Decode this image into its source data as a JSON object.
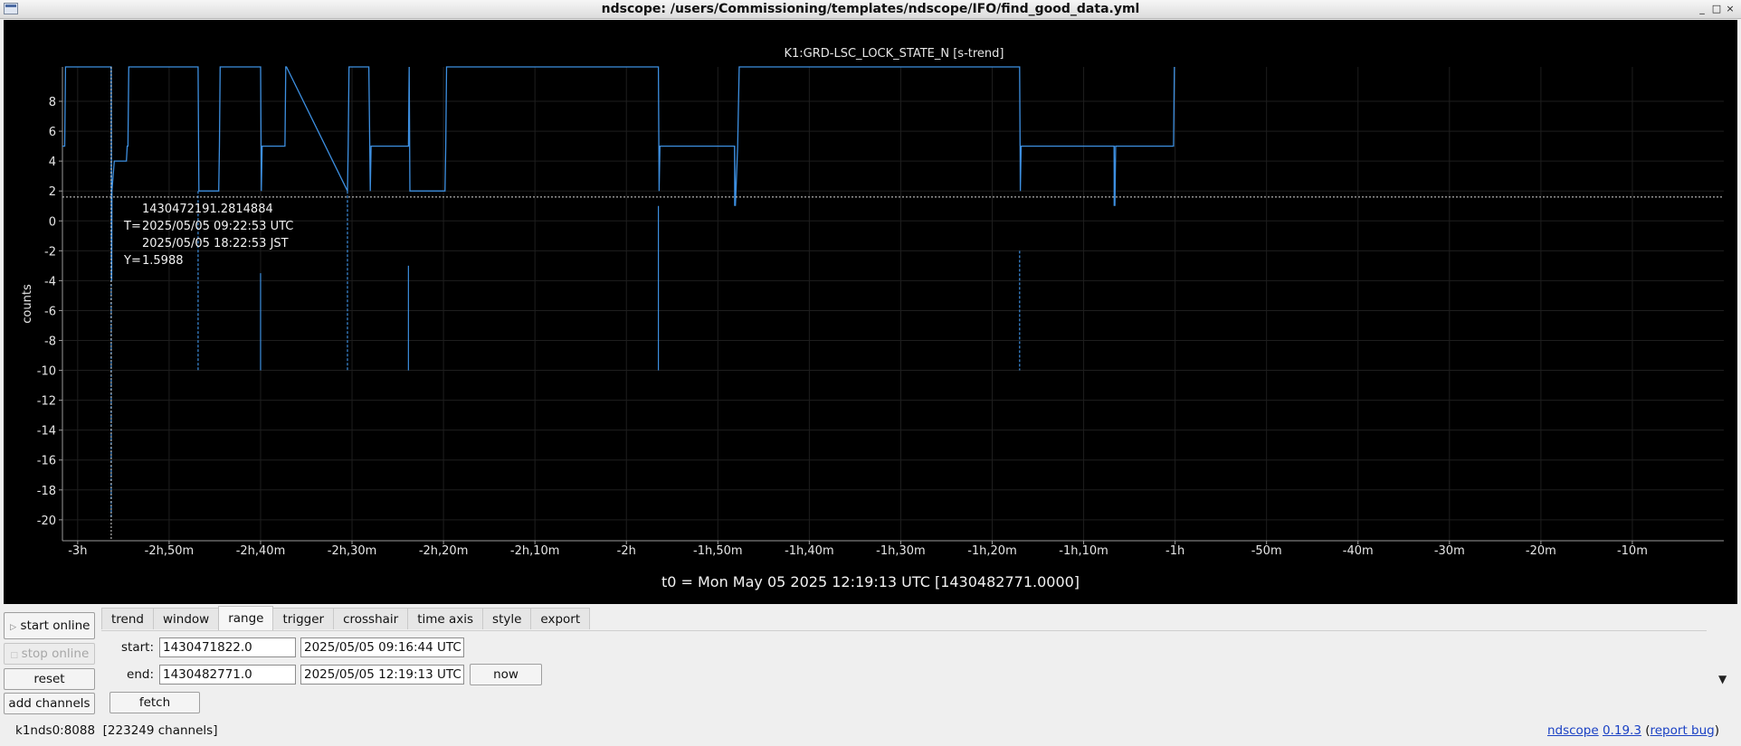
{
  "window": {
    "title": "ndscope: /users/Commissioning/templates/ndscope/IFO/find_good_data.yml",
    "controls": [
      "_",
      "□",
      "×"
    ]
  },
  "plot": {
    "channel_title": "K1:GRD-LSC_LOCK_STATE_N [s-trend]",
    "t0_label": "t0 = Mon May 05 2025 12:19:13 UTC [1430482771.0000]",
    "crosshair": {
      "gps": "1430472191.2814884",
      "t_prefix": "T=",
      "utc": "2025/05/05 09:22:53 UTC",
      "jst": "2025/05/05 18:22:53 JST",
      "y_prefix": "Y=",
      "y_value": "1.5988"
    }
  },
  "chart_data": {
    "type": "line",
    "title": "K1:GRD-LSC_LOCK_STATE_N [s-trend]",
    "xlabel": "t0 = Mon May 05 2025 12:19:13 UTC [1430482771.0000]",
    "ylabel": "counts",
    "xlim": [
      -10900,
      0
    ],
    "ylim": [
      -21.4,
      10.3
    ],
    "grid": true,
    "x_unit": "seconds relative to t0",
    "xticks": [
      {
        "value": -10800,
        "label": "-3h"
      },
      {
        "value": -10200,
        "label": "-2h,50m"
      },
      {
        "value": -9600,
        "label": "-2h,40m"
      },
      {
        "value": -9000,
        "label": "-2h,30m"
      },
      {
        "value": -8400,
        "label": "-2h,20m"
      },
      {
        "value": -7800,
        "label": "-2h,10m"
      },
      {
        "value": -7200,
        "label": "-2h"
      },
      {
        "value": -6600,
        "label": "-1h,50m"
      },
      {
        "value": -6000,
        "label": "-1h,40m"
      },
      {
        "value": -5400,
        "label": "-1h,30m"
      },
      {
        "value": -4800,
        "label": "-1h,20m"
      },
      {
        "value": -4200,
        "label": "-1h,10m"
      },
      {
        "value": -3600,
        "label": "-1h"
      },
      {
        "value": -3000,
        "label": "-50m"
      },
      {
        "value": -2400,
        "label": "-40m"
      },
      {
        "value": -1800,
        "label": "-30m"
      },
      {
        "value": -1200,
        "label": "-20m"
      },
      {
        "value": -600,
        "label": "-10m"
      }
    ],
    "yticks": [
      8,
      6,
      4,
      2,
      0,
      -2,
      -4,
      -6,
      -8,
      -10,
      -12,
      -14,
      -16,
      -18,
      -20
    ],
    "crosshair": {
      "x": -10580,
      "y": 1.5988
    },
    "series": [
      {
        "color": "#3d8fe0",
        "x": [
          -10900,
          -10885,
          -10880,
          -10580,
          -10577,
          -10575,
          -10560,
          -10480,
          -10475,
          -10470,
          -10465,
          -10010,
          -10005,
          -9875,
          -9870,
          -9865,
          -9600,
          -9595,
          -9590,
          -9440,
          -9435,
          -9430,
          -9030,
          -9025,
          -9020,
          -8890,
          -8880,
          -8875,
          -8630,
          -8625,
          -8620,
          -8390,
          -8385,
          -8380,
          -6990,
          -6985,
          -6980,
          -6490,
          -6485,
          -6470,
          -6460,
          -4620,
          -4615,
          -4610,
          -4000,
          -3995,
          -3990,
          -3610,
          -3605
        ],
        "y": [
          5,
          5,
          10.3,
          10.3,
          -4,
          2,
          4,
          4,
          5,
          5,
          10.3,
          10.3,
          2,
          2,
          5,
          10.3,
          10.3,
          2,
          5,
          5,
          10.3,
          10.3,
          2,
          5,
          10.3,
          10.3,
          2,
          5,
          5,
          10.3,
          2,
          2,
          5,
          10.3,
          10.3,
          2,
          5,
          5,
          1,
          5,
          10.3,
          10.3,
          2,
          5,
          5,
          1,
          5,
          5,
          10.3
        ]
      }
    ],
    "spikes": [
      {
        "x": -10580,
        "y_min": -20,
        "y_max": 10.3,
        "dashed": true
      },
      {
        "x": -10010,
        "y_min": -10,
        "y_max": 2,
        "dashed": true
      },
      {
        "x": -9600,
        "y_min": -10,
        "y_max": -3.5,
        "dashed": false
      },
      {
        "x": -9030,
        "y_min": -10,
        "y_max": 2,
        "dashed": true
      },
      {
        "x": -8630,
        "y_min": -10,
        "y_max": -3,
        "dashed": false
      },
      {
        "x": -6990,
        "y_min": -10,
        "y_max": 1,
        "dashed": false
      },
      {
        "x": -6490,
        "y_min": 1,
        "y_max": 5,
        "dashed": false
      },
      {
        "x": -4620,
        "y_min": -10,
        "y_max": -2,
        "dashed": true
      },
      {
        "x": -4000,
        "y_min": 1,
        "y_max": 5,
        "dashed": false
      }
    ]
  },
  "controls": {
    "start_online": "start online",
    "stop_online": "stop online",
    "reset": "reset",
    "add_channels": "add channels"
  },
  "tabs": [
    "trend",
    "window",
    "range",
    "trigger",
    "crosshair",
    "time axis",
    "style",
    "export"
  ],
  "active_tab": "range",
  "range": {
    "start_label": "start:",
    "start_gps": "1430471822.0",
    "start_utc": "2025/05/05 09:16:44 UTC",
    "end_label": "end:",
    "end_gps": "1430482771.0",
    "end_utc": "2025/05/05 12:19:13 UTC",
    "now_button": "now",
    "fetch_button": "fetch"
  },
  "status": {
    "server": "k1nds0:8088",
    "channels": "[223249 channels]"
  },
  "version": {
    "app_link": "ndscope",
    "version_link": "0.19.3",
    "open_paren": "(",
    "bug_link": "report bug",
    "close_paren": ")"
  },
  "colors": {
    "trace": "#3d8fe0",
    "background": "#000000",
    "link": "#1a41c4"
  }
}
